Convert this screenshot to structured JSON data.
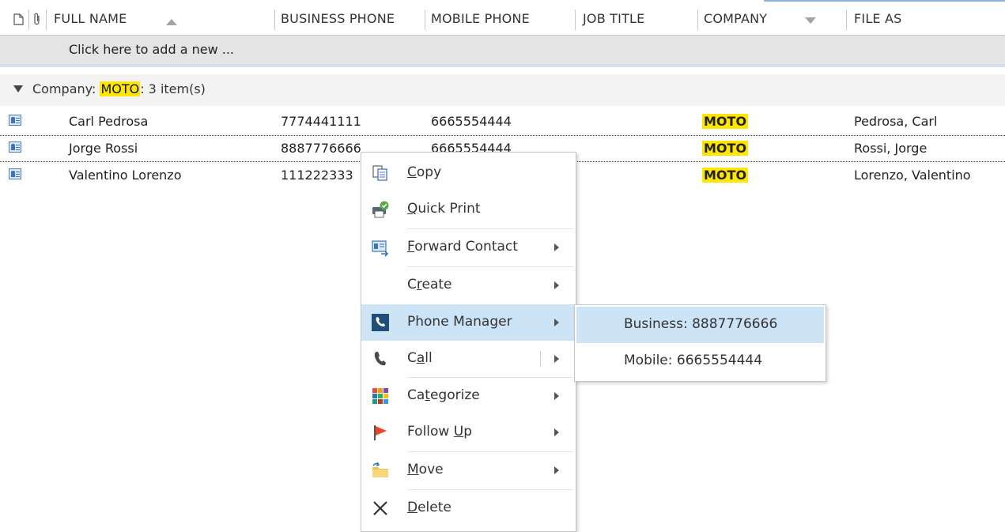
{
  "columns": {
    "full_name": "FULL NAME",
    "business_phone": "BUSINESS PHONE",
    "mobile_phone": "MOBILE PHONE",
    "job_title": "JOB TITLE",
    "company": "COMPANY",
    "file_as": "FILE AS"
  },
  "add_new_text": "Click here to add a new ...",
  "group": {
    "prefix": "Company: ",
    "name": "MOTO",
    "suffix": ": 3 item(s)"
  },
  "rows": [
    {
      "full_name": "Carl Pedrosa",
      "business_phone": "7774441111",
      "mobile_phone": "6665554444",
      "company": "MOTO",
      "file_as": "Pedrosa, Carl"
    },
    {
      "full_name": "Jorge Rossi",
      "business_phone": "8887776666",
      "mobile_phone": "6665554444",
      "company": "MOTO",
      "file_as": "Rossi, Jorge"
    },
    {
      "full_name": "Valentino Lorenzo",
      "business_phone": "111222333",
      "mobile_phone": "",
      "company": "MOTO",
      "file_as": "Lorenzo, Valentino"
    }
  ],
  "context_menu": {
    "copy": {
      "pre": "",
      "key": "C",
      "post": "opy"
    },
    "quick_print": {
      "pre": "",
      "key": "Q",
      "post": "uick Print"
    },
    "forward_contact": {
      "pre": "",
      "key": "F",
      "post": "orward Contact"
    },
    "create": {
      "pre": "C",
      "key": "r",
      "post": "eate"
    },
    "phone_manager": "Phone Manager",
    "call": {
      "pre": "C",
      "key": "a",
      "post": "ll"
    },
    "categorize": {
      "pre": "Ca",
      "key": "t",
      "post": "egorize"
    },
    "follow_up": {
      "pre": "Follow ",
      "key": "U",
      "post": "p"
    },
    "move": {
      "pre": "",
      "key": "M",
      "post": "ove"
    },
    "delete": {
      "pre": "",
      "key": "D",
      "post": "elete"
    }
  },
  "submenu": {
    "business": "Business: 8887776666",
    "mobile": "Mobile: 6665554444"
  },
  "icons": {
    "new-item": "document-icon",
    "attachment": "paperclip-icon",
    "contact": "contact-card-icon"
  },
  "colors": {
    "highlight": "#ffe600",
    "menu_hover": "#cde4f7",
    "phone_manager_icon": "#1f4e79",
    "follow_up_flag": "#e8462e"
  }
}
